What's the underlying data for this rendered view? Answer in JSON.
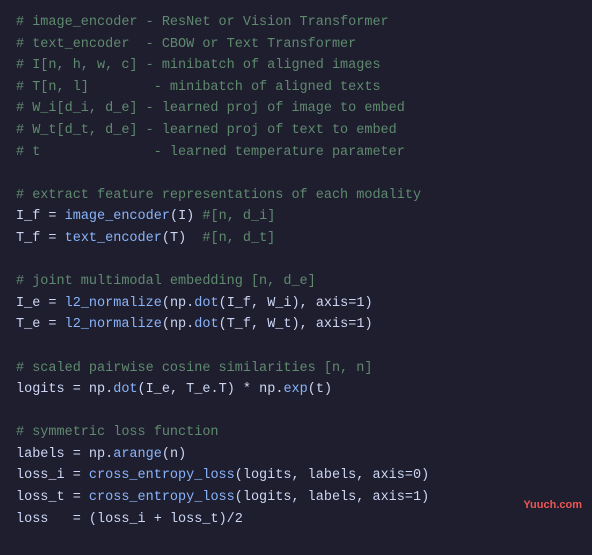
{
  "code": {
    "lines": [
      {
        "id": "l1",
        "text": "# image_encoder - ResNet or Vision Transformer",
        "type": "comment"
      },
      {
        "id": "l2",
        "text": "# text_encoder  - CBOW or Text Transformer",
        "type": "comment"
      },
      {
        "id": "l3",
        "text": "# I[n, h, w, c] - minibatch of aligned images",
        "type": "comment"
      },
      {
        "id": "l4",
        "text": "# T[n, l]        - minibatch of aligned texts",
        "type": "comment"
      },
      {
        "id": "l5",
        "text": "# W_i[d_i, d_e] - learned proj of image to embed",
        "type": "comment"
      },
      {
        "id": "l6",
        "text": "# W_t[d_t, d_e] - learned proj of text to embed",
        "type": "comment"
      },
      {
        "id": "l7",
        "text": "# t              - learned temperature parameter",
        "type": "comment"
      },
      {
        "id": "l8",
        "text": "",
        "type": "blank"
      },
      {
        "id": "l9",
        "text": "# extract feature representations of each modality",
        "type": "comment"
      },
      {
        "id": "l10",
        "text": "I_f = image_encoder(I) #[n, d_i]",
        "type": "code"
      },
      {
        "id": "l11",
        "text": "T_f = text_encoder(T)  #[n, d_t]",
        "type": "code"
      },
      {
        "id": "l12",
        "text": "",
        "type": "blank"
      },
      {
        "id": "l13",
        "text": "# joint multimodal embedding [n, d_e]",
        "type": "comment"
      },
      {
        "id": "l14",
        "text": "I_e = l2_normalize(np.dot(I_f, W_i), axis=1)",
        "type": "code"
      },
      {
        "id": "l15",
        "text": "T_e = l2_normalize(np.dot(T_f, W_t), axis=1)",
        "type": "code"
      },
      {
        "id": "l16",
        "text": "",
        "type": "blank"
      },
      {
        "id": "l17",
        "text": "# scaled pairwise cosine similarities [n, n]",
        "type": "comment"
      },
      {
        "id": "l18",
        "text": "logits = np.dot(I_e, T_e.T) * np.exp(t)",
        "type": "code"
      },
      {
        "id": "l19",
        "text": "",
        "type": "blank"
      },
      {
        "id": "l20",
        "text": "# symmetric loss function",
        "type": "comment"
      },
      {
        "id": "l21",
        "text": "labels = np.arange(n)",
        "type": "code"
      },
      {
        "id": "l22",
        "text": "loss_i = cross_entropy_loss(logits, labels, axis=0)",
        "type": "code"
      },
      {
        "id": "l23",
        "text": "loss_t = cross_entropy_loss(logits, labels, axis=1)",
        "type": "code"
      },
      {
        "id": "l24",
        "text": "loss   = (loss_i + loss_t)/2",
        "type": "code"
      }
    ],
    "watermark": "Yuuch.com"
  }
}
